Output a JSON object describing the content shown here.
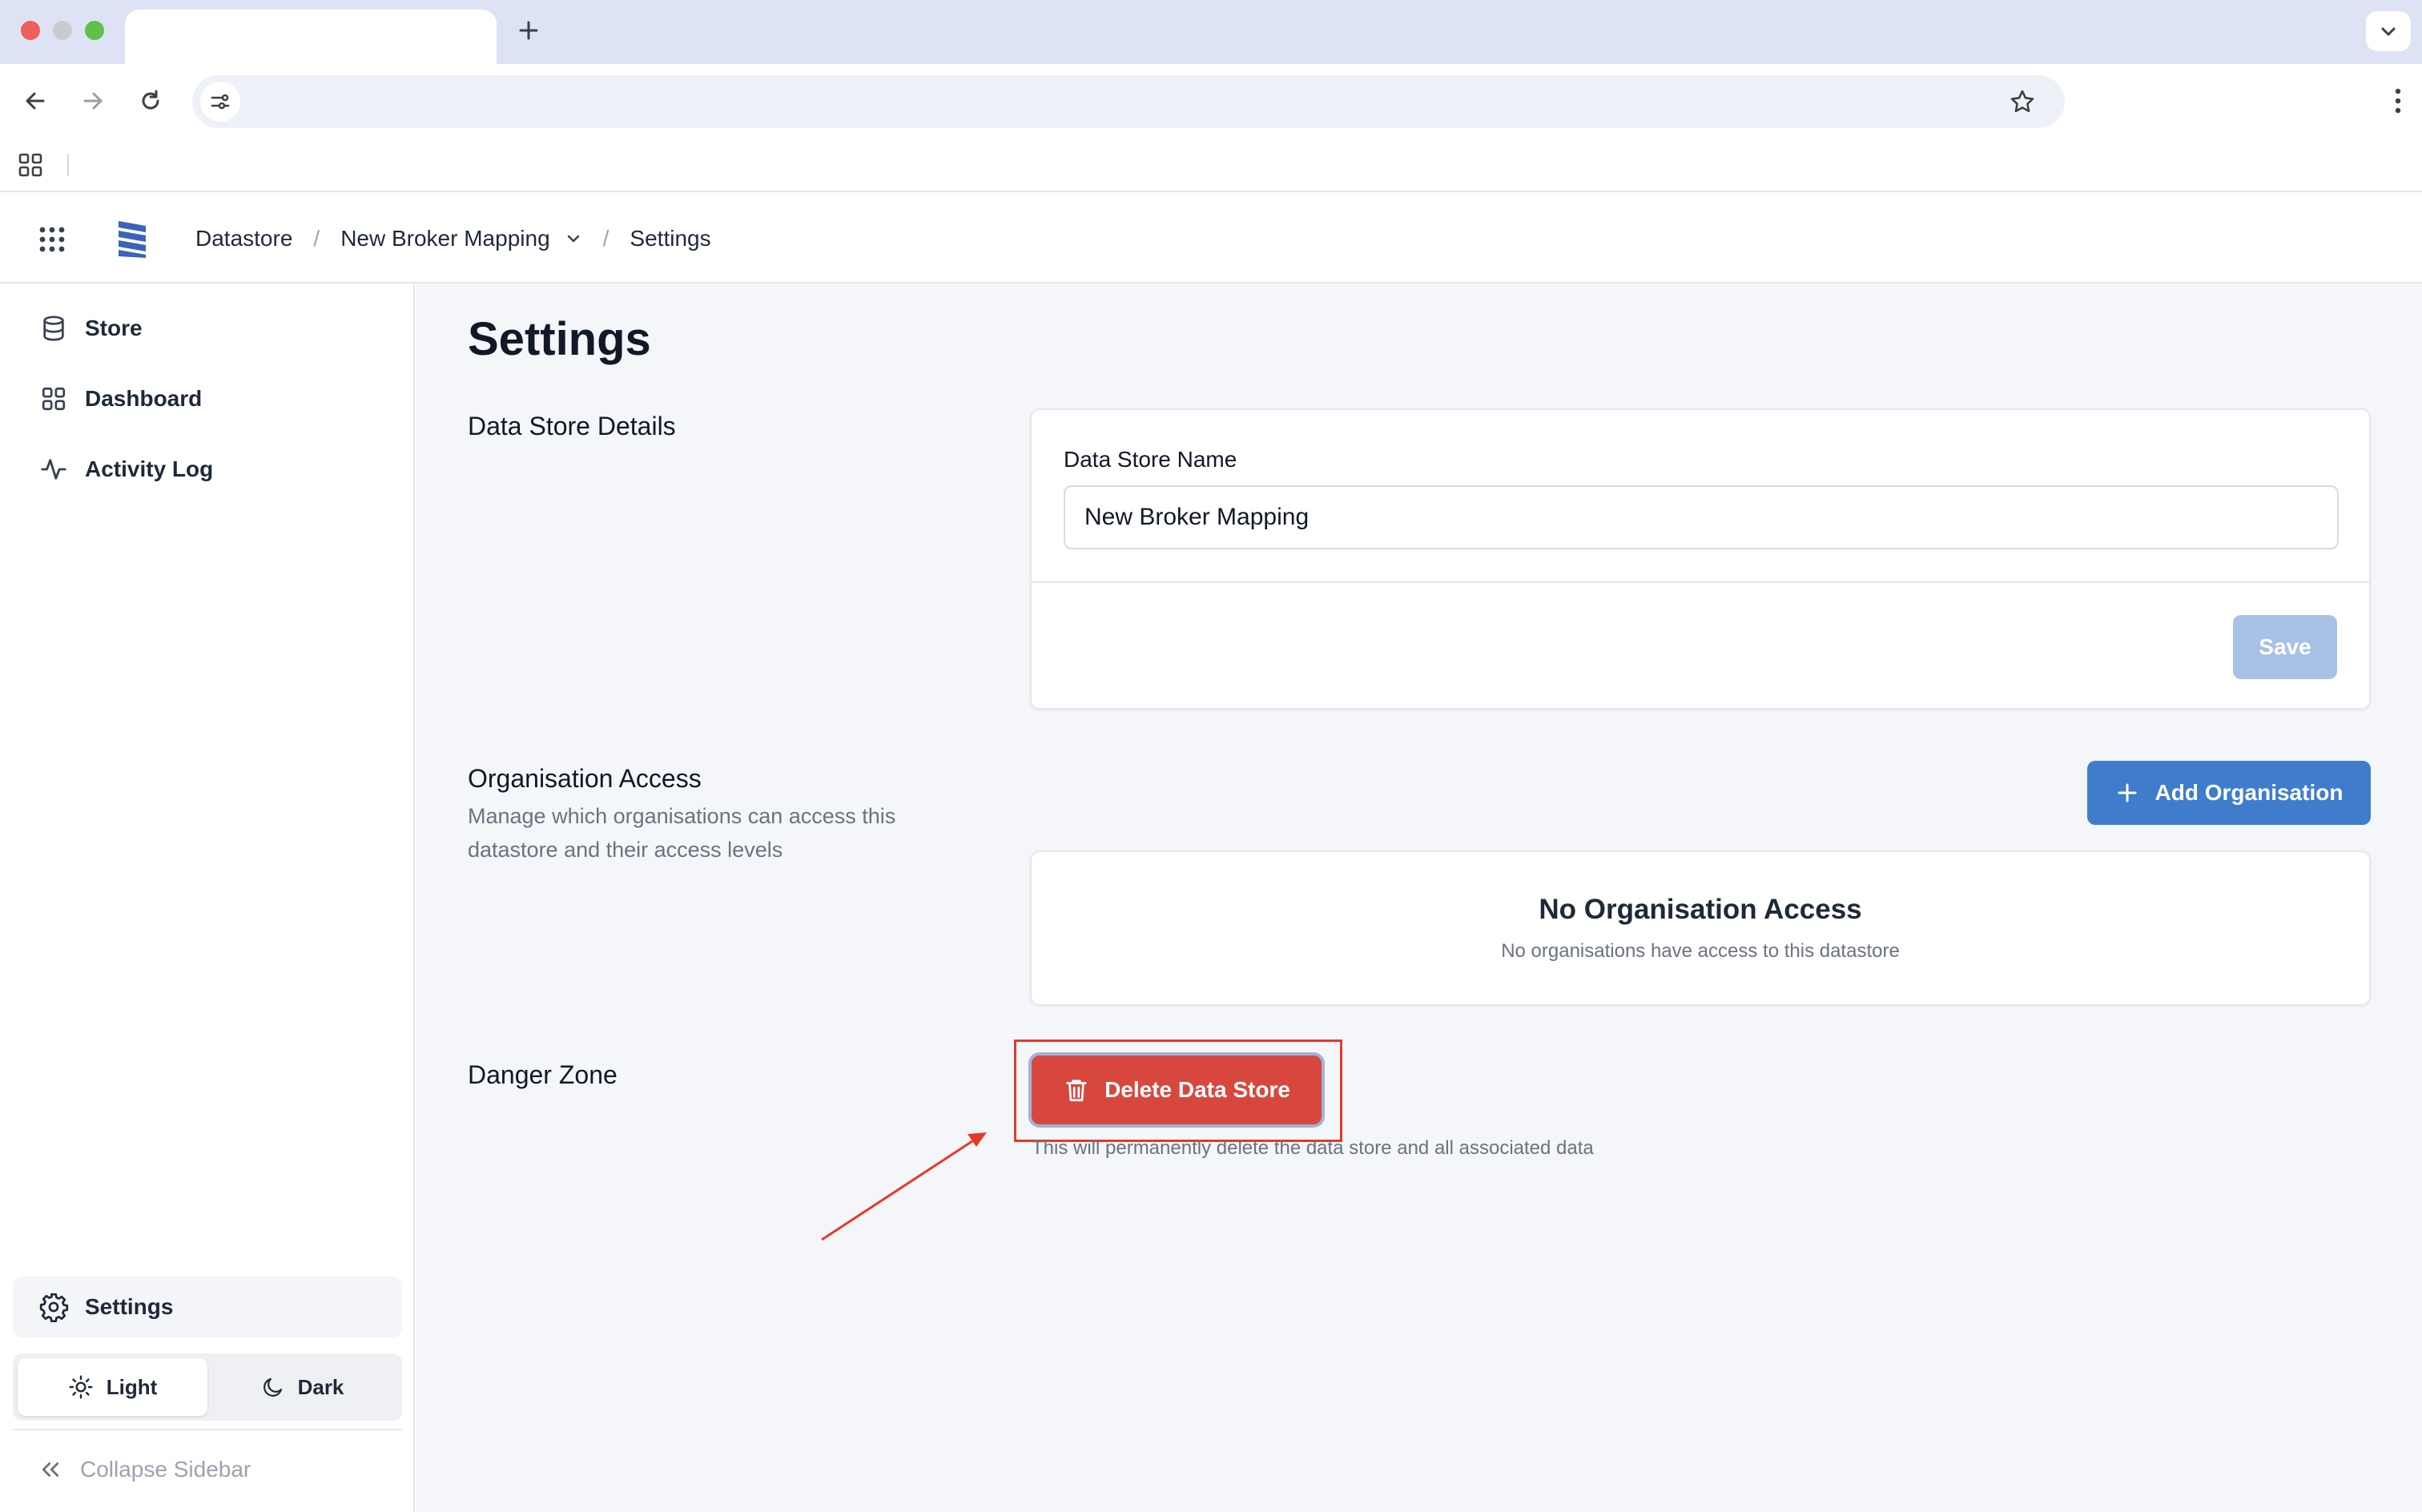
{
  "browser": {
    "tab_title": "",
    "url": ""
  },
  "header": {
    "breadcrumbs": [
      "Datastore",
      "New Broker Mapping",
      "Settings"
    ],
    "separator": "/"
  },
  "sidebar": {
    "items": [
      {
        "label": "Store",
        "icon": "database-icon"
      },
      {
        "label": "Dashboard",
        "icon": "dashboard-icon"
      },
      {
        "label": "Activity Log",
        "icon": "activity-icon"
      }
    ],
    "settings_label": "Settings",
    "theme": {
      "light": "Light",
      "dark": "Dark",
      "selected": "Light"
    },
    "collapse_label": "Collapse Sidebar"
  },
  "main": {
    "title": "Settings",
    "details": {
      "section_title": "Data Store Details",
      "field_label": "Data Store Name",
      "field_value": "New Broker Mapping",
      "save_label": "Save"
    },
    "org_access": {
      "section_title": "Organisation Access",
      "description": "Manage which organisations can access this datastore and their access levels",
      "add_label": "Add Organisation",
      "empty_title": "No Organisation Access",
      "empty_desc": "No organisations have access to this datastore"
    },
    "danger": {
      "section_title": "Danger Zone",
      "delete_label": "Delete Data Store",
      "note": "This will permanently delete the data store and all associated data"
    }
  },
  "colors": {
    "primary": "#3f7dcc",
    "primary_disabled": "#a8c1e6",
    "danger": "#d8473d",
    "annotation": "#e5392b",
    "logo": "#3b63b8"
  }
}
